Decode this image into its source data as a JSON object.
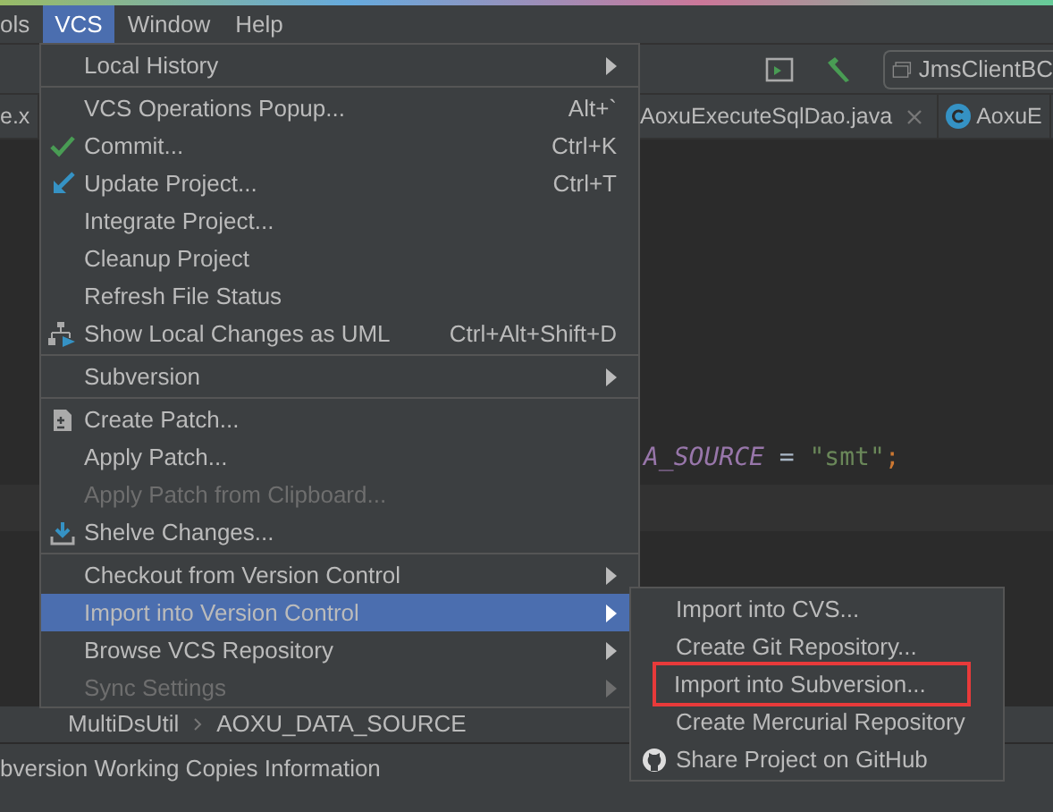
{
  "menu_bar": [
    {
      "label": "ols",
      "selected": false
    },
    {
      "label": "VCS",
      "selected": true
    },
    {
      "label": "Window",
      "selected": false
    },
    {
      "label": "Help",
      "selected": false
    }
  ],
  "toolbar": {
    "run_config": "JmsClientBC"
  },
  "editor_tabs": [
    {
      "label": "e.x",
      "closable": false
    },
    {
      "label": "AoxuExecuteSqlDao.java",
      "closable": true
    },
    {
      "label": "AoxuE",
      "closable": false
    }
  ],
  "code_line": [
    {
      "kind": "constant",
      "text": "A_SOURCE"
    },
    {
      "kind": "operator",
      "text": " = "
    },
    {
      "kind": "string",
      "text": "\"smt\""
    },
    {
      "kind": "punct",
      "text": ";"
    }
  ],
  "breadcrumb": [
    "MultiDsUtil",
    "AOXU_DATA_SOURCE"
  ],
  "status_bar": "bversion Working Copies Information",
  "vcs_menu": [
    {
      "kind": "item",
      "label": "Local History",
      "submenu": true,
      "disabled": false,
      "selected": false
    },
    {
      "kind": "separator"
    },
    {
      "kind": "item",
      "label": "VCS Operations Popup...",
      "shortcut": "Alt+`",
      "submenu": false,
      "disabled": false,
      "selected": false
    },
    {
      "kind": "item",
      "label": "Commit...",
      "shortcut": "Ctrl+K",
      "submenu": false,
      "disabled": false,
      "selected": false
    },
    {
      "kind": "item",
      "label": "Update Project...",
      "shortcut": "Ctrl+T",
      "submenu": false,
      "disabled": false,
      "selected": false
    },
    {
      "kind": "item",
      "label": "Integrate Project...",
      "submenu": false,
      "disabled": false,
      "selected": false
    },
    {
      "kind": "item",
      "label": "Cleanup Project",
      "submenu": false,
      "disabled": false,
      "selected": false
    },
    {
      "kind": "item",
      "label": "Refresh File Status",
      "submenu": false,
      "disabled": false,
      "selected": false
    },
    {
      "kind": "item",
      "label": "Show Local Changes as UML",
      "shortcut": "Ctrl+Alt+Shift+D",
      "submenu": false,
      "disabled": false,
      "selected": false
    },
    {
      "kind": "separator"
    },
    {
      "kind": "item",
      "label": "Subversion",
      "submenu": true,
      "disabled": false,
      "selected": false
    },
    {
      "kind": "separator"
    },
    {
      "kind": "item",
      "label": "Create Patch...",
      "submenu": false,
      "disabled": false,
      "selected": false
    },
    {
      "kind": "item",
      "label": "Apply Patch...",
      "submenu": false,
      "disabled": false,
      "selected": false
    },
    {
      "kind": "item",
      "label": "Apply Patch from Clipboard...",
      "submenu": false,
      "disabled": true,
      "selected": false
    },
    {
      "kind": "item",
      "label": "Shelve Changes...",
      "submenu": false,
      "disabled": false,
      "selected": false
    },
    {
      "kind": "separator"
    },
    {
      "kind": "item",
      "label": "Checkout from Version Control",
      "submenu": true,
      "disabled": false,
      "selected": false
    },
    {
      "kind": "item",
      "label": "Import into Version Control",
      "submenu": true,
      "disabled": false,
      "selected": true
    },
    {
      "kind": "item",
      "label": "Browse VCS Repository",
      "submenu": true,
      "disabled": false,
      "selected": false
    },
    {
      "kind": "item",
      "label": "Sync Settings",
      "submenu": true,
      "disabled": true,
      "selected": false
    }
  ],
  "import_submenu": [
    {
      "label": "Import into CVS...",
      "highlighted": false
    },
    {
      "label": "Create Git Repository...",
      "highlighted": false
    },
    {
      "label": "Import into Subversion...",
      "highlighted": true
    },
    {
      "label": "Create Mercurial Repository",
      "highlighted": false
    },
    {
      "label": "Share Project on GitHub",
      "highlighted": false
    }
  ]
}
